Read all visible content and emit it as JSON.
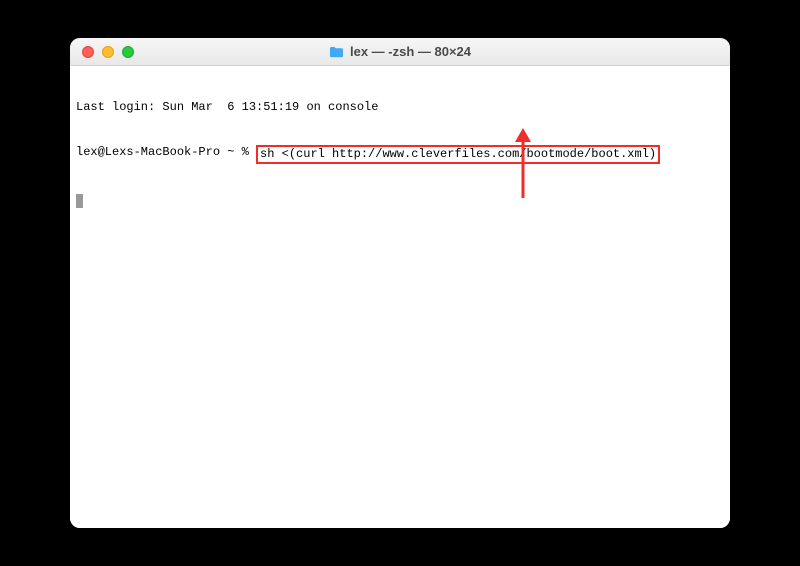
{
  "window": {
    "title": "lex — -zsh — 80×24"
  },
  "terminal": {
    "last_login": "Last login: Sun Mar  6 13:51:19 on console",
    "prompt": "lex@Lexs-MacBook-Pro ~ % ",
    "command": "sh <(curl http://www.cleverfiles.com/bootmode/boot.xml)"
  },
  "annotation": {
    "arrow_color": "#ef2e2a",
    "box_color": "#ef2e2a"
  }
}
